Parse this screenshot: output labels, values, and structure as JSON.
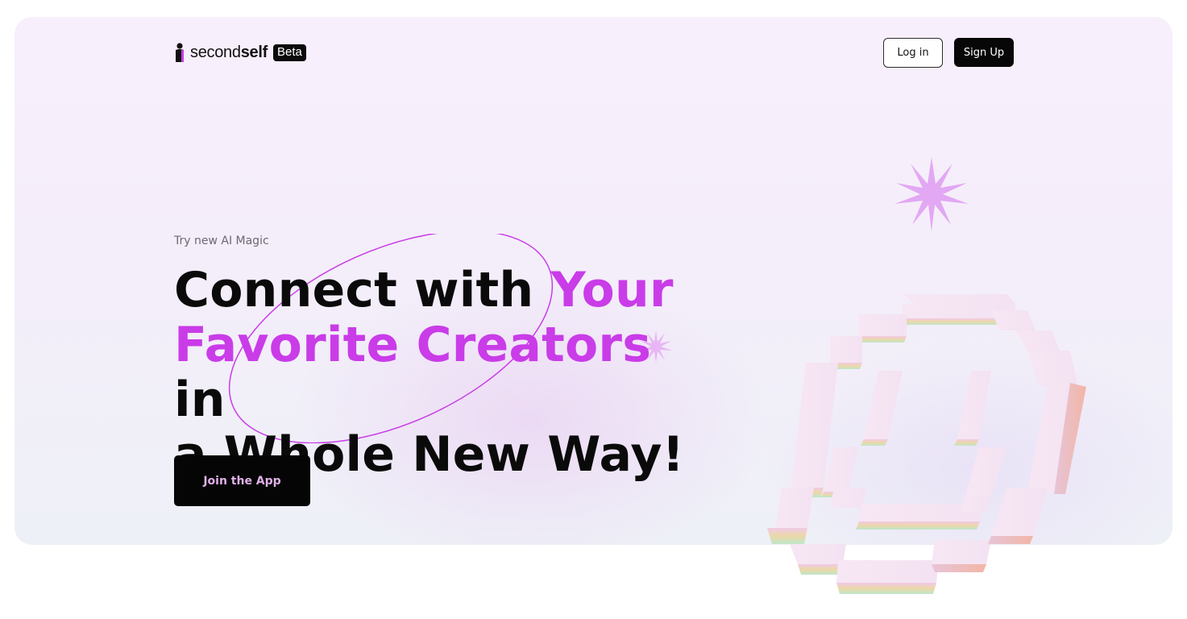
{
  "brand": {
    "name_light": "second",
    "name_bold": "self",
    "badge": "Beta"
  },
  "nav": {
    "login_label": "Log in",
    "signup_label": "Sign Up"
  },
  "hero": {
    "eyebrow": "Try new AI Magic",
    "headline": {
      "part1": "Connect with ",
      "highlight1": "Your",
      "highlight2": "Favorite Creators",
      "part2": " in",
      "part3": "a Whole New Way!"
    },
    "cta_label": "Join the App"
  },
  "icons": {
    "logo": "person-silhouette-icon",
    "star_large": "sparkle-star-icon",
    "star_small": "sparkle-star-icon",
    "illustration": "pixel-smiley-face"
  },
  "colors": {
    "accent": "#c93ce8",
    "dark": "#070707",
    "star": "#e2a8f3",
    "cta_text": "#e0b0e8"
  }
}
